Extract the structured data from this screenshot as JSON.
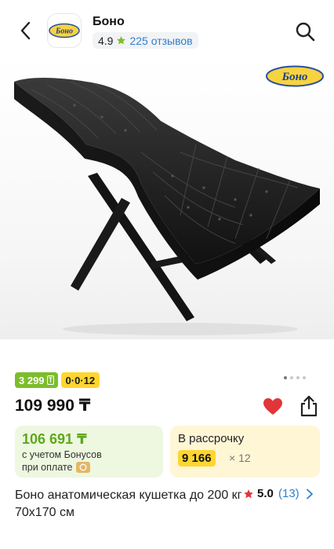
{
  "header": {
    "shop_name": "Боно",
    "logo_text": "Боно",
    "rating": "4.9",
    "reviews": "225 отзывов"
  },
  "photo": {
    "watermark": "Боно"
  },
  "badges": {
    "bonus_price": "3 299",
    "installment_code": "0·0·12"
  },
  "gallery": {
    "dots_count": 4,
    "active_index": 0
  },
  "price": {
    "value": "109 990 ₸"
  },
  "bonus_card": {
    "price": "106 691 ₸",
    "note_line1": "с учетом Бонусов",
    "note_line2": "при оплате"
  },
  "installment_card": {
    "title": "В рассрочку",
    "amount": "9 166",
    "times": "× 12"
  },
  "product": {
    "title": "Боно анатомическая кушетка до 200 кг 70x170 см",
    "rating": "5.0",
    "reviews_count": "(13)"
  },
  "colors": {
    "green": "#7cbd2c",
    "yellow": "#ffd630",
    "heart": "#e0363a",
    "link": "#2f7fd0"
  }
}
